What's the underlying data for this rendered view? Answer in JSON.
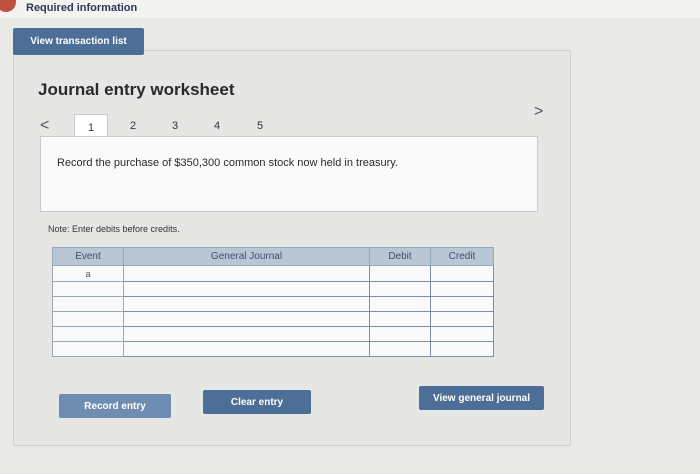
{
  "header": {
    "required_info": "Required information",
    "view_transactions_label": "View transaction list"
  },
  "worksheet": {
    "title": "Journal entry worksheet",
    "tabs": [
      "1",
      "2",
      "3",
      "4",
      "5"
    ],
    "active_tab": "1",
    "instruction": "Record the purchase of $350,300 common stock now held in treasury.",
    "note": "Note: Enter debits before credits."
  },
  "table": {
    "columns": [
      "Event",
      "General Journal",
      "Debit",
      "Credit"
    ],
    "rows": [
      {
        "event": "a",
        "journal": "",
        "debit": "",
        "credit": ""
      },
      {
        "event": "",
        "journal": "",
        "debit": "",
        "credit": ""
      },
      {
        "event": "",
        "journal": "",
        "debit": "",
        "credit": ""
      },
      {
        "event": "",
        "journal": "",
        "debit": "",
        "credit": ""
      },
      {
        "event": "",
        "journal": "",
        "debit": "",
        "credit": ""
      },
      {
        "event": "",
        "journal": "",
        "debit": "",
        "credit": ""
      }
    ]
  },
  "buttons": {
    "record": "Record entry",
    "clear": "Clear entry",
    "view_journal": "View general journal"
  },
  "colors": {
    "button": "#4d6e97",
    "header_row": "#b9c6d6",
    "alert_icon": "#c0513e"
  }
}
